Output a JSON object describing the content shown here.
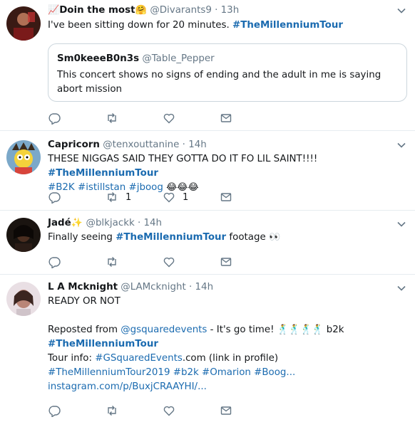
{
  "tweets": [
    {
      "name_prefix": "📈",
      "name": "Doin the most",
      "name_suffix": "🤗",
      "handle": "@Divarants9",
      "dot": "·",
      "time": "13h",
      "text_plain": "I've been sitting down for 20 minutes. ",
      "hashtag": "#TheMillenniumTour",
      "quote": {
        "name": "Sm0keeeB0n3s",
        "handle": "@Table_Pepper",
        "text": "This concert shows no signs of ending and the adult in me is saying abort mission"
      }
    },
    {
      "name": "Capricorn",
      "handle": "@tenxouttanine",
      "dot": "·",
      "time": "14h",
      "text_plain": "THESE NIGGAS SAID THEY GOTTA DO IT FO LIL SAINT!!!! ",
      "hashtag": "#TheMillenniumTour",
      "line2_tags": [
        "#B2K",
        "#istillstan",
        "#jboog"
      ],
      "line2_emoji": "😂😂😂",
      "retweets": "1",
      "likes": "1"
    },
    {
      "name": "Jadé",
      "name_suffix": "✨",
      "handle": "@blkjackk",
      "dot": "·",
      "time": "14h",
      "text_plain": "Finally seeing  ",
      "hashtag": "#TheMillenniumTour",
      "text_after": " footage ",
      "emoji": "👀"
    },
    {
      "name": "L A Mcknight",
      "handle": "@LAMcknight",
      "dot": "·",
      "time": "14h",
      "line1": "READY OR NOT",
      "repost_prefix": "Reposted from ",
      "repost_mention": "@gsquaredevents",
      "repost_mid": "  -  It's go time! ",
      "dancers": "🕺🕺🕺🕺",
      "repost_tail": "  b2k",
      "hashtag": "#TheMillenniumTour",
      "tour_info_prefix": "Tour info: ",
      "tour_info_tag": "#GSquaredEvents",
      "tour_info_suffix": ".com (link in profile)",
      "tags_line": "#TheMillenniumTour2019 #b2k #Omarion #Boog...",
      "link": "instagram.com/p/BuxjCRAAYHI/..."
    }
  ]
}
